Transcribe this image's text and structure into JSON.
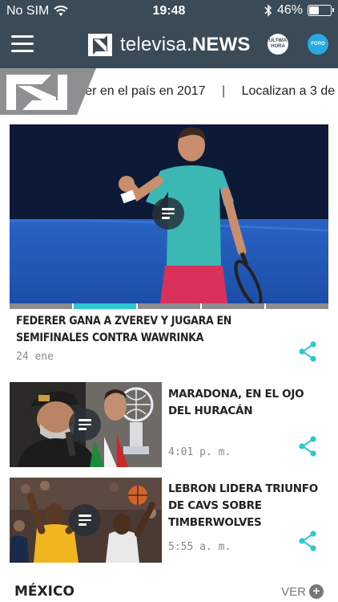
{
  "status_bar": {
    "carrier": "No SIM",
    "time": "19:48",
    "battery": "46%",
    "battery_level": 0.46
  },
  "header": {
    "brand_light": "televisa.",
    "brand_bold": "NEWS",
    "ultima_line1": "ULTIMA",
    "ultima_line2": "HORA",
    "foro_label": "FORO"
  },
  "ticker": {
    "items": [
      "reer en el país en 2017",
      "Localizan a 3 de"
    ],
    "separator": "|"
  },
  "hero": {
    "title": "FEDERER GANA A ZVEREV Y JUGARA EN SEMIFINALES CONTRA WAWRINKA",
    "date": "24 ene",
    "slides": 5,
    "active_slide": 2
  },
  "articles": [
    {
      "title": "MARADONA, EN EL OJO DEL HURACÁN",
      "time": "4:01 p. m."
    },
    {
      "title": "LEBRON LIDERA TRIUNFO DE CAVS SOBRE TIMBERWOLVES",
      "time": "5:55 a. m."
    }
  ],
  "section": {
    "title": "MÉXICO",
    "more_label": "VER"
  },
  "colors": {
    "header_bg": "#3a4a57",
    "accent": "#2dc7cf",
    "share_icon": "#2dc7cf"
  }
}
